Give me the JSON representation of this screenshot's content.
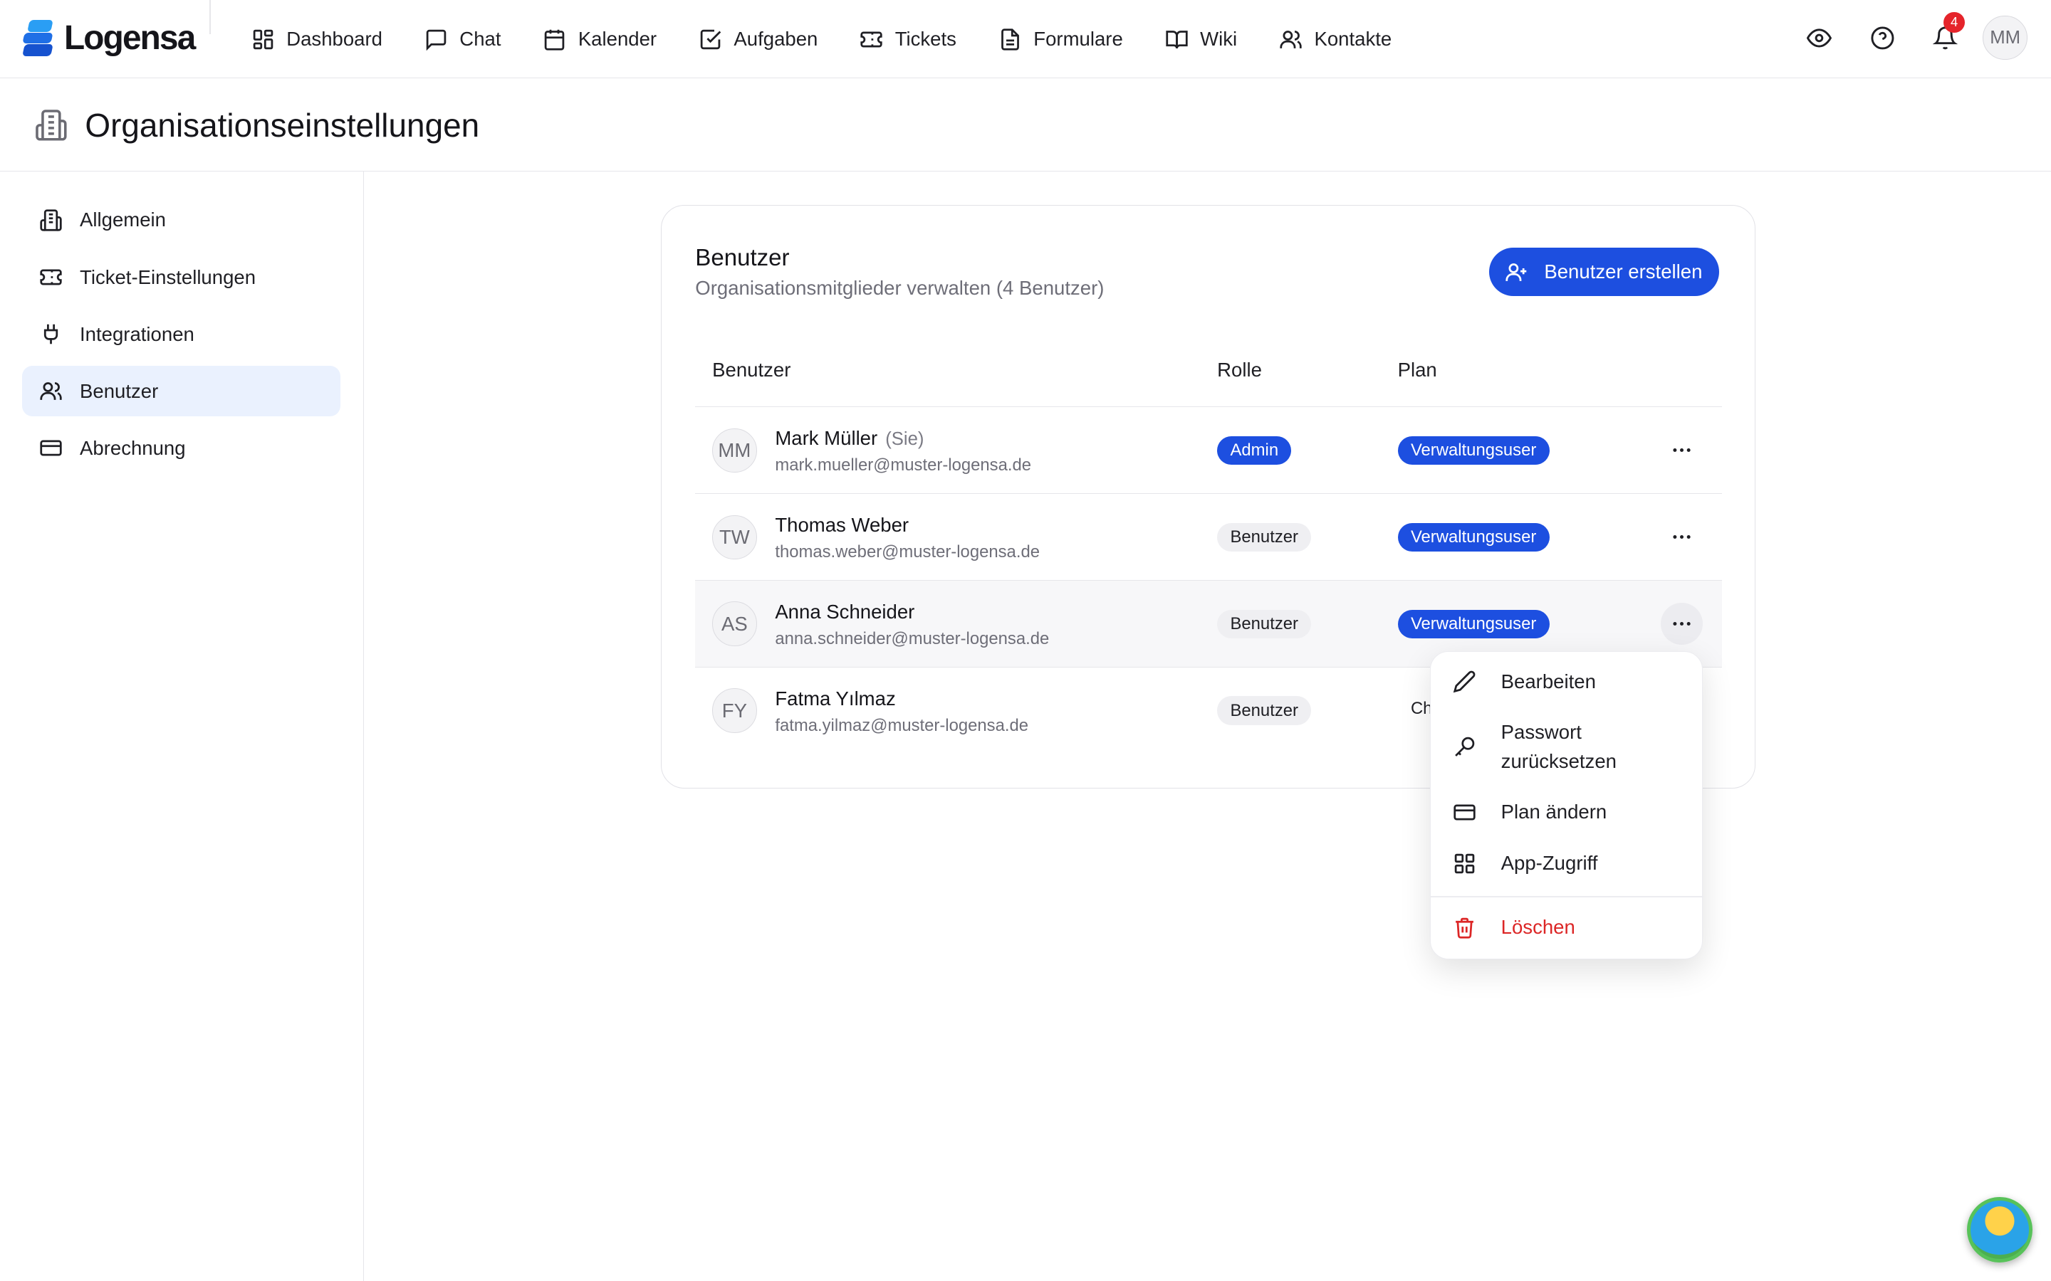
{
  "brand": {
    "name": "Logensa",
    "primary_color": "#1d4fe0",
    "logo_color": "#1f8ef1"
  },
  "nav": [
    {
      "label": "Dashboard",
      "icon": "dashboard-icon"
    },
    {
      "label": "Chat",
      "icon": "chat-icon"
    },
    {
      "label": "Kalender",
      "icon": "calendar-icon"
    },
    {
      "label": "Aufgaben",
      "icon": "task-check-icon"
    },
    {
      "label": "Tickets",
      "icon": "ticket-icon"
    },
    {
      "label": "Formulare",
      "icon": "document-icon"
    },
    {
      "label": "Wiki",
      "icon": "book-icon"
    },
    {
      "label": "Kontakte",
      "icon": "contacts-icon"
    }
  ],
  "topbar": {
    "notifications_count": "4",
    "user_initials": "MM"
  },
  "page": {
    "title": "Organisationseinstellungen"
  },
  "sidebar": {
    "items": [
      {
        "label": "Allgemein",
        "icon": "building-icon"
      },
      {
        "label": "Ticket-Einstellungen",
        "icon": "ticket-icon"
      },
      {
        "label": "Integrationen",
        "icon": "plug-icon"
      },
      {
        "label": "Benutzer",
        "icon": "users-icon",
        "active": true
      },
      {
        "label": "Abrechnung",
        "icon": "credit-card-icon"
      }
    ]
  },
  "users_card": {
    "title": "Benutzer",
    "subtitle": "Organisationsmitglieder verwalten (4 Benutzer)",
    "create_button": "Benutzer erstellen",
    "columns": [
      "Benutzer",
      "Rolle",
      "Plan"
    ],
    "rows": [
      {
        "initials": "MM",
        "name": "Mark Müller",
        "you": "(Sie)",
        "email": "mark.mueller@muster-logensa.de",
        "role": "Admin",
        "plan": "Verwaltungsuser"
      },
      {
        "initials": "TW",
        "name": "Thomas Weber",
        "you": "",
        "email": "thomas.weber@muster-logensa.de",
        "role": "Benutzer",
        "plan": "Verwaltungsuser"
      },
      {
        "initials": "AS",
        "name": "Anna Schneider",
        "you": "",
        "email": "anna.schneider@muster-logensa.de",
        "role": "Benutzer",
        "plan": "Verwaltungsuser"
      },
      {
        "initials": "FY",
        "name": "Fatma Yılmaz",
        "you": "",
        "email": "fatma.yilmaz@muster-logensa.de",
        "role": "Benutzer",
        "plan": "Ch"
      }
    ]
  },
  "context_menu": {
    "items": [
      {
        "label": "Bearbeiten",
        "icon": "pencil-icon"
      },
      {
        "label": "Passwort zurücksetzen",
        "icon": "key-icon"
      },
      {
        "label": "Plan ändern",
        "icon": "credit-card-icon"
      },
      {
        "label": "App-Zugriff",
        "icon": "grid-icon"
      },
      {
        "label": "Löschen",
        "icon": "trash-icon",
        "danger_color": "#dc2626"
      }
    ]
  }
}
